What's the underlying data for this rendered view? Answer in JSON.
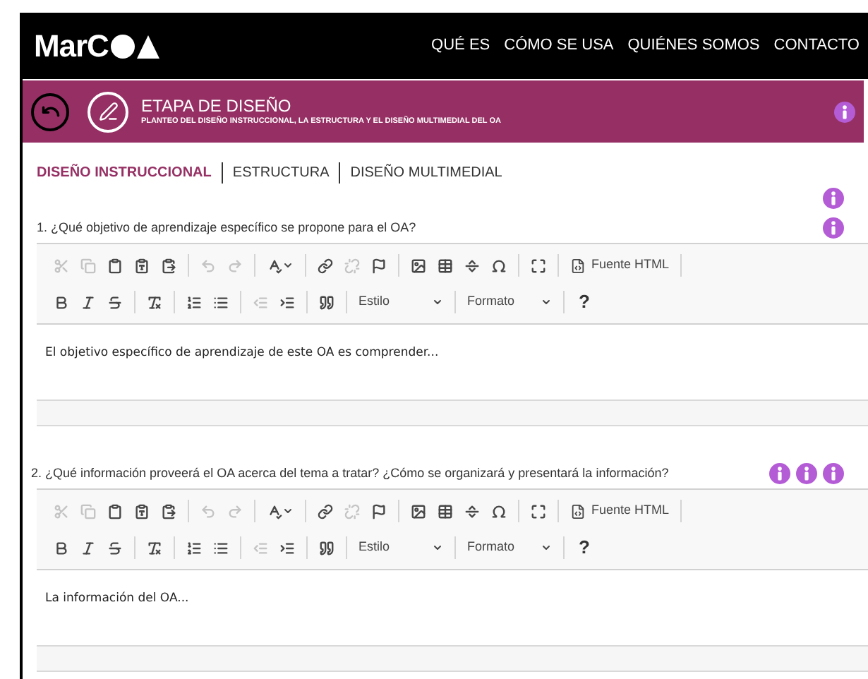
{
  "header": {
    "logo": "MarC",
    "nav": [
      {
        "label": "QUÉ ES"
      },
      {
        "label": "CÓMO SE USA"
      },
      {
        "label": "QUIÉNES SOMOS"
      },
      {
        "label": "CONTACTO"
      }
    ]
  },
  "stage": {
    "title": "ETAPA DE DISEÑO",
    "subtitle": "PLANTEO DEL DISEÑO INSTRUCCIONAL, LA ESTRUCTURA Y EL DISEÑO MULTIMEDIAL DEL OA"
  },
  "tabs": [
    {
      "label": "DISEÑO INSTRUCCIONAL",
      "selected": true
    },
    {
      "label": "ESTRUCTURA",
      "selected": false
    },
    {
      "label": "DISEÑO MULTIMEDIAL",
      "selected": false
    }
  ],
  "questions": [
    {
      "question": "1. ¿Qué objetivo de aprendizaje específico se propone para el OA?",
      "info_icons": [
        {
          "kind": "info"
        }
      ],
      "content": "El objetivo específico de aprendizaje de este OA es comprender...",
      "toolbar": [
        [
          {
            "kind": "button",
            "disabled": true
          },
          {
            "kind": "button",
            "disabled": true
          },
          {
            "kind": "button",
            "disabled": false
          },
          {
            "kind": "button",
            "disabled": false
          },
          {
            "kind": "button",
            "disabled": false
          },
          {
            "kind": "separator"
          },
          {
            "kind": "button",
            "disabled": true
          },
          {
            "kind": "button",
            "disabled": true
          },
          {
            "kind": "separator"
          },
          {
            "kind": "button",
            "disabled": false
          },
          {
            "kind": "separator"
          },
          {
            "kind": "button",
            "disabled": false
          },
          {
            "kind": "button",
            "disabled": true
          },
          {
            "kind": "button",
            "disabled": false
          },
          {
            "kind": "separator"
          },
          {
            "kind": "button",
            "disabled": false
          },
          {
            "kind": "button",
            "disabled": false
          },
          {
            "kind": "button",
            "disabled": false
          },
          {
            "kind": "button",
            "disabled": false
          },
          {
            "kind": "separator"
          },
          {
            "kind": "button",
            "disabled": false
          },
          {
            "kind": "separator"
          },
          {
            "kind": "text_button",
            "label": "Fuente HTML"
          },
          {
            "kind": "separator"
          }
        ],
        [
          {
            "kind": "button",
            "disabled": false
          },
          {
            "kind": "button",
            "disabled": false
          },
          {
            "kind": "button",
            "disabled": false
          },
          {
            "kind": "separator"
          },
          {
            "kind": "button",
            "disabled": false
          },
          {
            "kind": "separator"
          },
          {
            "kind": "button",
            "disabled": false
          },
          {
            "kind": "button",
            "disabled": false
          },
          {
            "kind": "separator"
          },
          {
            "kind": "button",
            "disabled": true
          },
          {
            "kind": "button",
            "disabled": false
          },
          {
            "kind": "separator"
          },
          {
            "kind": "button",
            "disabled": false
          },
          {
            "kind": "separator"
          },
          {
            "kind": "dropdown",
            "label": "Estilo"
          },
          {
            "kind": "separator"
          },
          {
            "kind": "dropdown",
            "label": "Formato"
          },
          {
            "kind": "separator"
          },
          {
            "kind": "char_button",
            "label": "?"
          }
        ]
      ]
    },
    {
      "question": "2. ¿Qué información proveerá el OA acerca del tema a tratar? ¿Cómo se organizará y presentará la información?",
      "info_icons": [
        {
          "kind": "info"
        },
        {
          "kind": "info"
        },
        {
          "kind": "info"
        }
      ],
      "content": "La información del OA...",
      "toolbar": [
        [
          {
            "kind": "button",
            "disabled": true
          },
          {
            "kind": "button",
            "disabled": true
          },
          {
            "kind": "button",
            "disabled": false
          },
          {
            "kind": "button",
            "disabled": false
          },
          {
            "kind": "button",
            "disabled": false
          },
          {
            "kind": "separator"
          },
          {
            "kind": "button",
            "disabled": true
          },
          {
            "kind": "button",
            "disabled": true
          },
          {
            "kind": "separator"
          },
          {
            "kind": "button",
            "disabled": false
          },
          {
            "kind": "separator"
          },
          {
            "kind": "button",
            "disabled": false
          },
          {
            "kind": "button",
            "disabled": true
          },
          {
            "kind": "button",
            "disabled": false
          },
          {
            "kind": "separator"
          },
          {
            "kind": "button",
            "disabled": false
          },
          {
            "kind": "button",
            "disabled": false
          },
          {
            "kind": "button",
            "disabled": false
          },
          {
            "kind": "button",
            "disabled": false
          },
          {
            "kind": "separator"
          },
          {
            "kind": "button",
            "disabled": false
          },
          {
            "kind": "separator"
          },
          {
            "kind": "text_button",
            "label": "Fuente HTML"
          },
          {
            "kind": "separator"
          }
        ],
        [
          {
            "kind": "button",
            "disabled": false
          },
          {
            "kind": "button",
            "disabled": false
          },
          {
            "kind": "button",
            "disabled": false
          },
          {
            "kind": "separator"
          },
          {
            "kind": "button",
            "disabled": false
          },
          {
            "kind": "separator"
          },
          {
            "kind": "button",
            "disabled": false
          },
          {
            "kind": "button",
            "disabled": false
          },
          {
            "kind": "separator"
          },
          {
            "kind": "button",
            "disabled": true
          },
          {
            "kind": "button",
            "disabled": false
          },
          {
            "kind": "separator"
          },
          {
            "kind": "button",
            "disabled": false
          },
          {
            "kind": "separator"
          },
          {
            "kind": "dropdown",
            "label": "Estilo"
          },
          {
            "kind": "separator"
          },
          {
            "kind": "dropdown",
            "label": "Formato"
          },
          {
            "kind": "separator"
          },
          {
            "kind": "char_button",
            "label": "?"
          }
        ]
      ]
    }
  ]
}
